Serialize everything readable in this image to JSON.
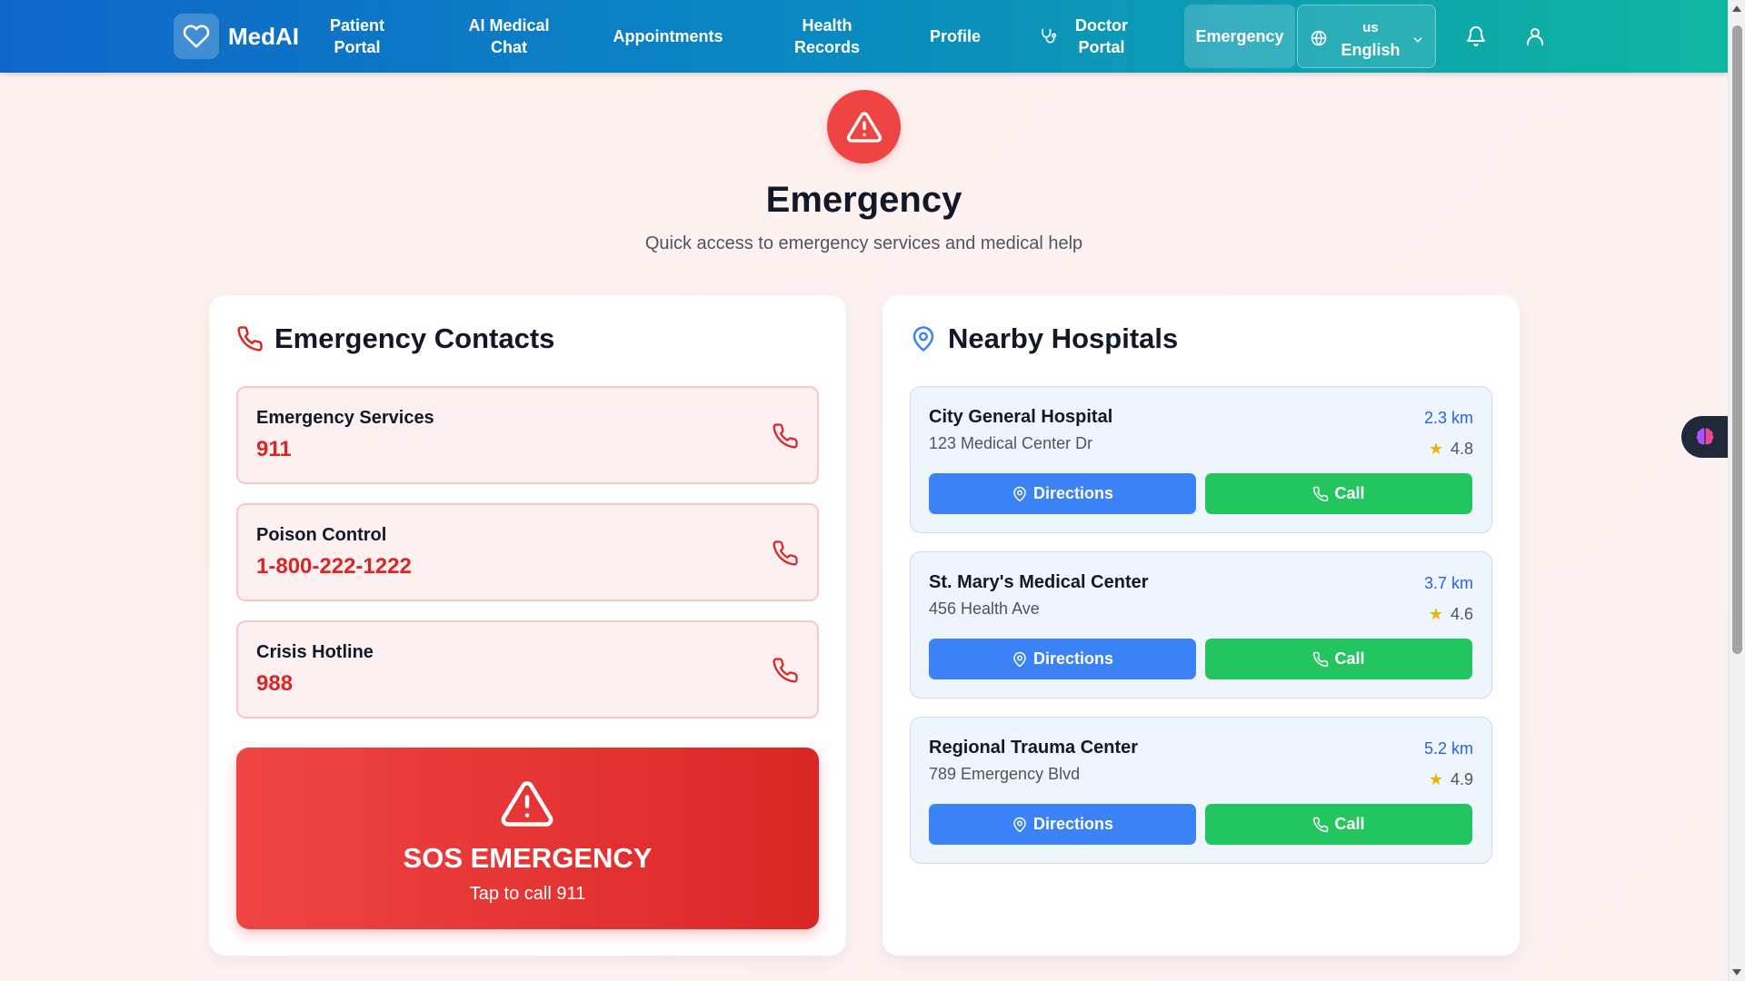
{
  "header": {
    "brand": "MedAI",
    "nav": [
      {
        "label": "Patient Portal"
      },
      {
        "label": "AI Medical Chat"
      },
      {
        "label": "Appointments"
      },
      {
        "label": "Health Records"
      },
      {
        "label": "Profile"
      },
      {
        "label": "Doctor Portal"
      },
      {
        "label": "Emergency"
      }
    ],
    "language": {
      "code": "us",
      "name": "English"
    }
  },
  "hero": {
    "title": "Emergency",
    "subtitle": "Quick access to emergency services and medical help"
  },
  "contacts": {
    "title": "Emergency Contacts",
    "items": [
      {
        "name": "Emergency Services",
        "number": "911"
      },
      {
        "name": "Poison Control",
        "number": "1-800-222-1222"
      },
      {
        "name": "Crisis Hotline",
        "number": "988"
      }
    ],
    "sos": {
      "title": "SOS EMERGENCY",
      "subtitle": "Tap to call 911"
    }
  },
  "hospitals": {
    "title": "Nearby Hospitals",
    "items": [
      {
        "name": "City General Hospital",
        "address": "123 Medical Center Dr",
        "distance": "2.3 km",
        "rating": "4.8",
        "directions_label": "Directions",
        "call_label": "Call"
      },
      {
        "name": "St. Mary's Medical Center",
        "address": "456 Health Ave",
        "distance": "3.7 km",
        "rating": "4.6",
        "directions_label": "Directions",
        "call_label": "Call"
      },
      {
        "name": "Regional Trauma Center",
        "address": "789 Emergency Blvd",
        "distance": "5.2 km",
        "rating": "4.9",
        "directions_label": "Directions",
        "call_label": "Call"
      }
    ]
  },
  "icons": {
    "logo": "heart-icon",
    "doctor": "stethoscope-icon",
    "language": "globe-icon",
    "dropdown": "chevron-down-icon",
    "notifications": "bell-icon",
    "user": "user-icon",
    "warning": "alert-triangle-icon",
    "phone": "phone-icon",
    "location": "map-pin-icon",
    "rating": "star-icon",
    "assistant": "brain-icon"
  },
  "colors": {
    "header_start": "#0f66c9",
    "header_end": "#10b6a0",
    "emergency_red": "#dc2626",
    "directions_blue": "#3b82f6",
    "call_green": "#22c55e",
    "distance_blue": "#2563eb",
    "star_yellow": "#eab308"
  }
}
